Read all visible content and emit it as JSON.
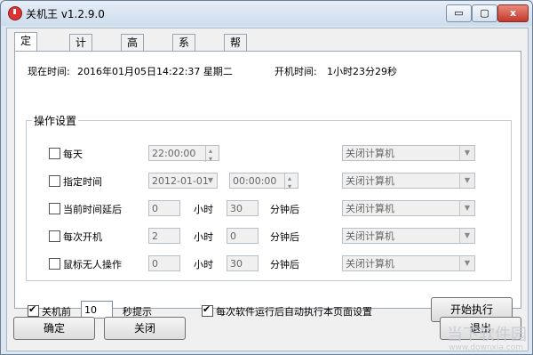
{
  "window": {
    "title": "关机王 v1.2.9.0",
    "min_label": "▭",
    "max_label": "▢",
    "close_label": "x"
  },
  "tabs": [
    "定时关机",
    "计划任务",
    "高级功能",
    "系统设置",
    "帮助"
  ],
  "status": {
    "current_time_label": "现在时间:",
    "current_time_value": "2016年01月05日14:22:37 星期二",
    "uptime_label": "开机时间:",
    "uptime_value": "1小时23分29秒"
  },
  "group_title": "操作设置",
  "rows": [
    {
      "label": "每天",
      "time": "22:00:00",
      "action": "关闭计算机"
    },
    {
      "label": "指定时间",
      "date": "2012-01-01",
      "time": "00:00:00",
      "action": "关闭计算机"
    },
    {
      "label": "当前时间延后",
      "hours": "0",
      "hours_unit": "小时",
      "minutes": "30",
      "minutes_unit": "分钟后",
      "action": "关闭计算机"
    },
    {
      "label": "每次开机",
      "hours": "2",
      "hours_unit": "小时",
      "minutes": "0",
      "minutes_unit": "分钟后",
      "action": "关闭计算机"
    },
    {
      "label": "鼠标无人操作",
      "hours": "0",
      "hours_unit": "小时",
      "minutes": "30",
      "minutes_unit": "分钟后",
      "action": "关闭计算机"
    }
  ],
  "bottom": {
    "prompt_label": "关机前",
    "prompt_value": "10",
    "prompt_suffix": "秒提示",
    "autorun_label": "每次软件运行后自动执行本页面设置",
    "start_button": "开始执行"
  },
  "buttons": {
    "ok": "确定",
    "close": "关闭",
    "exit": "退出"
  },
  "watermark": {
    "text": "当下软件园",
    "sub": "www.downxia.com"
  }
}
